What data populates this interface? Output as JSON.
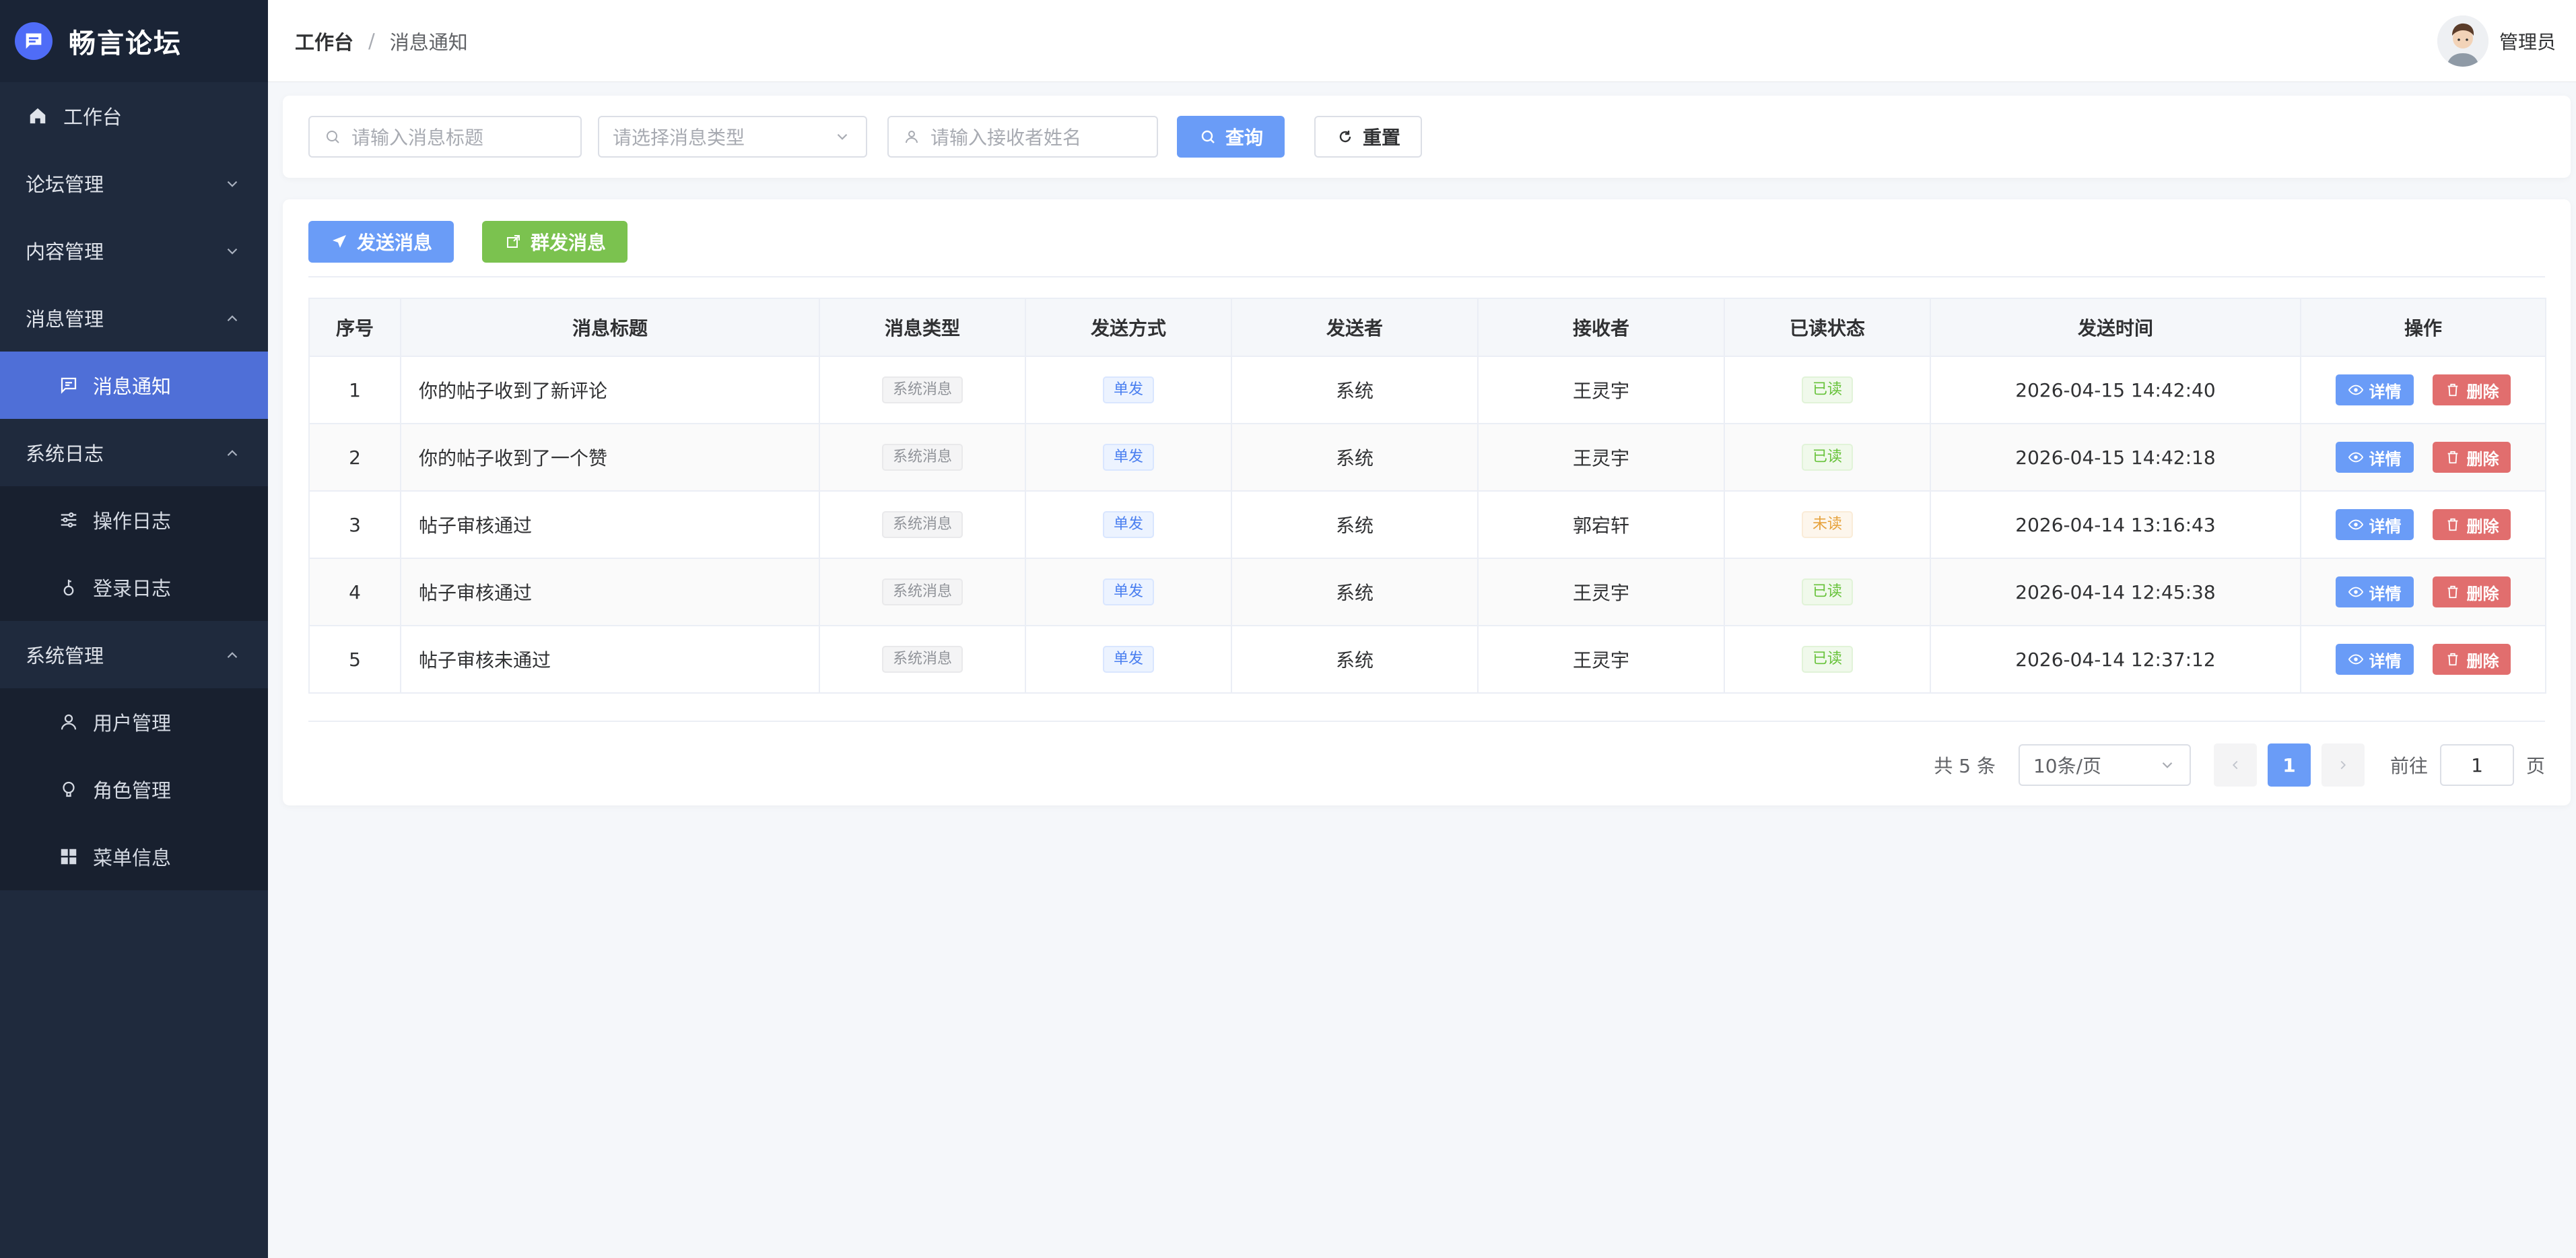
{
  "app": {
    "name": "畅言论坛"
  },
  "sidebar": {
    "items": [
      {
        "label": "工作台"
      },
      {
        "label": "论坛管理"
      },
      {
        "label": "内容管理"
      },
      {
        "label": "消息管理",
        "children": [
          {
            "label": "消息通知"
          }
        ]
      },
      {
        "label": "系统日志",
        "children": [
          {
            "label": "操作日志"
          },
          {
            "label": "登录日志"
          }
        ]
      },
      {
        "label": "系统管理",
        "children": [
          {
            "label": "用户管理"
          },
          {
            "label": "角色管理"
          },
          {
            "label": "菜单信息"
          }
        ]
      }
    ]
  },
  "header": {
    "breadcrumb": [
      "工作台",
      "消息通知"
    ],
    "separator": "/",
    "user": "管理员"
  },
  "search": {
    "title_placeholder": "请输入消息标题",
    "type_placeholder": "请选择消息类型",
    "receiver_placeholder": "请输入接收者姓名",
    "query_label": "查询",
    "reset_label": "重置"
  },
  "toolbar": {
    "send_label": "发送消息",
    "broadcast_label": "群发消息"
  },
  "table": {
    "columns": [
      "序号",
      "消息标题",
      "消息类型",
      "发送方式",
      "发送者",
      "接收者",
      "已读状态",
      "发送时间",
      "操作"
    ],
    "rows": [
      {
        "no": "1",
        "title": "你的帖子收到了新评论",
        "type": "系统消息",
        "method": "单发",
        "sender": "系统",
        "receiver": "王灵宇",
        "status": "已读",
        "time": "2026-04-15 14:42:40"
      },
      {
        "no": "2",
        "title": "你的帖子收到了一个赞",
        "type": "系统消息",
        "method": "单发",
        "sender": "系统",
        "receiver": "王灵宇",
        "status": "已读",
        "time": "2026-04-15 14:42:18"
      },
      {
        "no": "3",
        "title": "帖子审核通过",
        "type": "系统消息",
        "method": "单发",
        "sender": "系统",
        "receiver": "郭宕轩",
        "status": "未读",
        "time": "2026-04-14 13:16:43"
      },
      {
        "no": "4",
        "title": "帖子审核通过",
        "type": "系统消息",
        "method": "单发",
        "sender": "系统",
        "receiver": "王灵宇",
        "status": "已读",
        "time": "2026-04-14 12:45:38"
      },
      {
        "no": "5",
        "title": "帖子审核未通过",
        "type": "系统消息",
        "method": "单发",
        "sender": "系统",
        "receiver": "王灵宇",
        "status": "已读",
        "time": "2026-04-14 12:37:12"
      }
    ],
    "detail_label": "详情",
    "delete_label": "删除"
  },
  "pagination": {
    "total_text": "共 5 条",
    "page_size": "10条/页",
    "current_page": "1",
    "goto_prefix": "前往",
    "goto_value": "1",
    "goto_suffix": "页"
  },
  "colors": {
    "sidebar_bg": "#1f2a3d",
    "active_menu": "#4f6fd7",
    "primary": "#6a9cf7",
    "success": "#7bc24f",
    "danger": "#e16e6e"
  }
}
